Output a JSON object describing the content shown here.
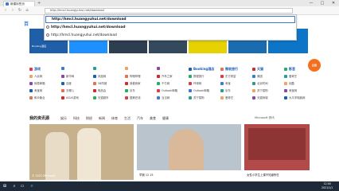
{
  "browser": {
    "tab_title": "新建标签页",
    "new_tab_symbol": "+",
    "window_controls": {
      "minimize": "—",
      "maximize": "□",
      "close": "✕"
    },
    "address_value": "http://hmcl.huangyuhui.net/download",
    "nav": {
      "back": "‹",
      "forward": "›",
      "refresh": "↻",
      "home": "⌂"
    }
  },
  "dropdown": {
    "input_value": "http://hmcl.huangyuhui.net/download",
    "items": [
      "http://hmcl.huangyuhui.net/download",
      "http://hmcl.huangyuhui.net/download"
    ]
  },
  "page": {
    "logo_text": "百",
    "tiles": [
      {
        "label": "Booking酒店",
        "color": "#1f5fa8"
      },
      {
        "label": "",
        "color": "#1e90ff"
      },
      {
        "label": "",
        "color": "#2c3e50"
      },
      {
        "label": "",
        "color": "#34495e"
      },
      {
        "label": "",
        "color": "#e6d200"
      },
      {
        "label": "",
        "color": "#1a6bb0"
      },
      {
        "label": "",
        "color": "#0d75c7"
      }
    ],
    "categories": [
      {
        "title": "游戏",
        "links": [
          "人民网",
          "网易邮箱",
          "淘宝网",
          "和众聚合"
        ]
      },
      {
        "title": "",
        "links": [
          "新华网",
          "百度",
          "去哪儿",
          "ASUS游戏"
        ]
      },
      {
        "title": "",
        "links": [
          "凤凰网",
          "58同城",
          "唯品会",
          "天猫超市"
        ]
      },
      {
        "title": "",
        "links": [
          "哔哩哔哩",
          "我爱我家",
          "京东",
          "国美在线"
        ]
      },
      {
        "title": "",
        "links": [
          "汽车之家",
          "千牛网",
          "Outlook邮箱",
          "当当网"
        ]
      },
      {
        "title": "Booking酒店",
        "links": [
          "携程旅行",
          "环球网",
          "Outlook邮箱",
          "苏宁易购"
        ]
      },
      {
        "title": "微软旅行",
        "links": [
          "东方财富",
          "淘宝",
          "京东",
          "爱奇艺"
        ]
      },
      {
        "title": "天猫",
        "links": [
          "美团",
          "北京时间",
          "苏宁易购",
          "天猫商城"
        ]
      },
      {
        "title": "影音",
        "links": [
          "爱奇艺",
          "优酷",
          "淘宝网",
          "大平洋电脑网"
        ]
      }
    ],
    "feedback_btn": "反馈"
  },
  "news": {
    "title": "我的资讯源",
    "tabs": [
      "娱乐",
      "科技",
      "财经",
      "新闻",
      "体育",
      "生活",
      "汽车",
      "美食",
      "健康"
    ],
    "source_label": "Microsoft 资讯",
    "captions": [
      {
        "text": "© 2022 Microsoft",
        "color": "#ffffff"
      },
      {
        "text": "早报 12 15",
        "color": "#222222"
      },
      {
        "text": "女性小学生上课不知道所在",
        "color": "#222222"
      }
    ],
    "images": [
      {
        "name": "family-photo",
        "color": "#c7b08c"
      },
      {
        "name": "woman-portrait",
        "color": "#b9c4cc"
      },
      {
        "name": "fashion-store",
        "color": "#b24a4a"
      }
    ]
  },
  "taskbar": {
    "start": "⊞",
    "time": "12:00",
    "date": "2021/1/1"
  }
}
